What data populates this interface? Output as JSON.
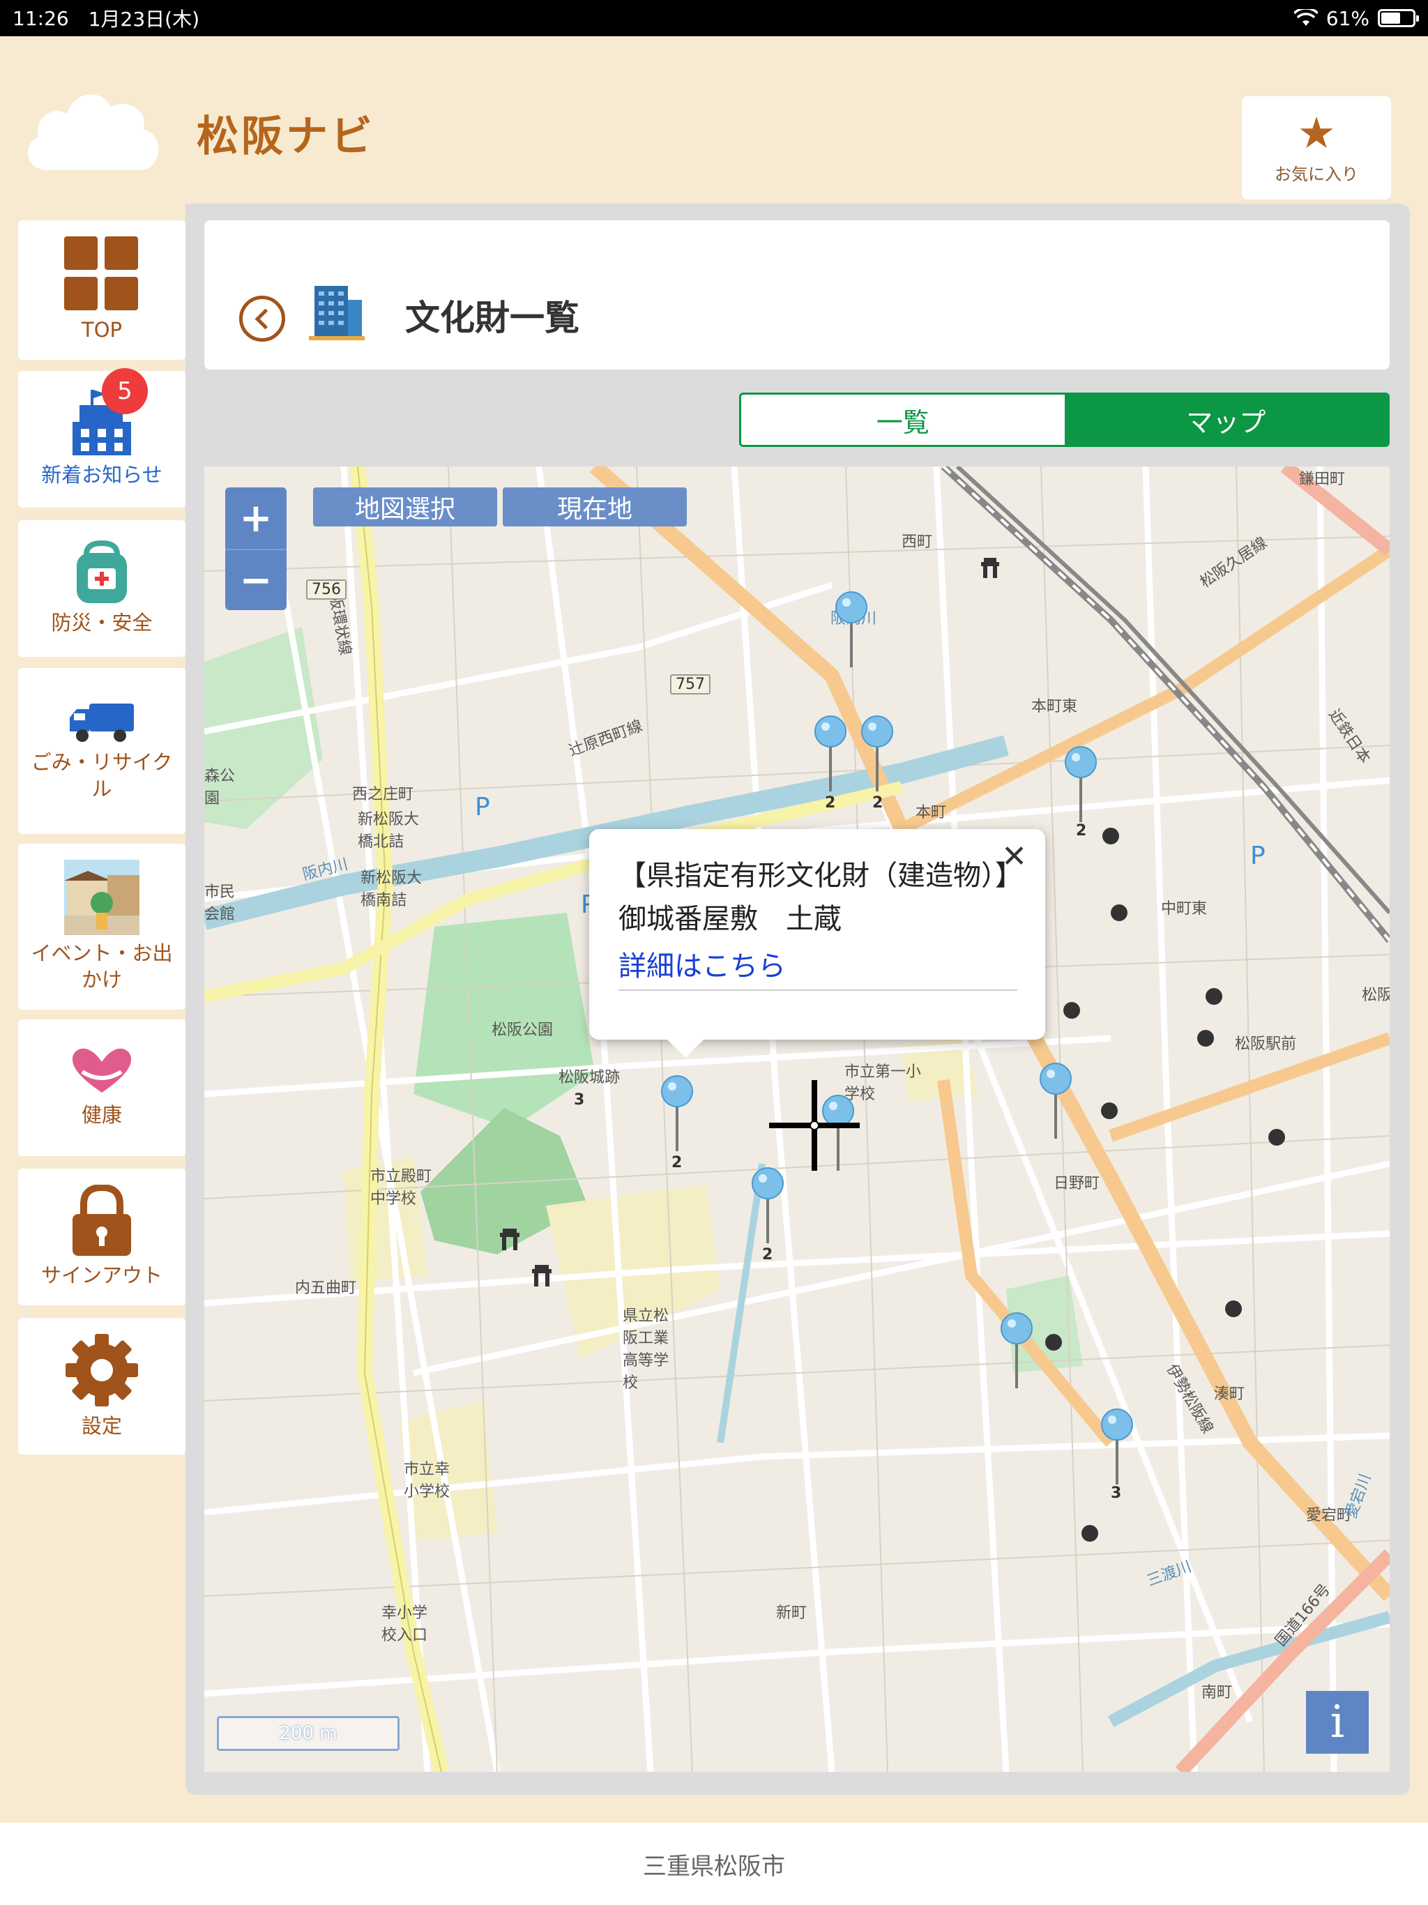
{
  "status_bar": {
    "time": "11:26",
    "date": "1月23日(木)",
    "battery": "61%",
    "battery_level": 0.61
  },
  "header": {
    "app_title": "松阪ナビ",
    "favorite_label": "お気に入り"
  },
  "sidebar": {
    "items": [
      {
        "label": "TOP",
        "icon": "grid-icon"
      },
      {
        "label": "新着お知らせ",
        "icon": "building-icon",
        "badge": "5"
      },
      {
        "label": "防災・安全",
        "icon": "backpack-icon"
      },
      {
        "label": "ごみ・リサイクル",
        "icon": "garbage-truck-icon"
      },
      {
        "label": "イベント・お出かけ",
        "icon": "event-icon"
      },
      {
        "label": "健康",
        "icon": "heart-hands-icon"
      },
      {
        "label": "サインアウト",
        "icon": "lock-icon"
      },
      {
        "label": "設定",
        "icon": "gear-icon"
      }
    ]
  },
  "main": {
    "title": "文化財一覧",
    "tabs": [
      {
        "label": "一覧",
        "selected": false
      },
      {
        "label": "マップ",
        "selected": true
      }
    ],
    "map": {
      "zoom_in": "+",
      "zoom_out": "−",
      "select_map_label": "地図選択",
      "current_location_label": "現在地",
      "popup": {
        "title": "【県指定有形文化財（建造物）】　御城番屋敷　土蔵",
        "link": "詳細はこちら"
      },
      "scale": "200 m",
      "info": "i",
      "labels": [
        "鎌田町",
        "西町",
        "阪内川",
        "本町東",
        "松阪久居線",
        "辻原西町線",
        "西之庄町",
        "新松阪大橋北詰",
        "新松阪大橋南詰",
        "森公園",
        "市民会館",
        "松阪公園",
        "松阪城跡",
        "中町東",
        "松阪駅前",
        "市立第一小学校",
        "日野町",
        "市立殿町中学校",
        "内五曲町",
        "県立松阪工業高等学校",
        "湊町",
        "市立幸小学校",
        "新町",
        "幸小学校入口",
        "愛宕町",
        "国道166号",
        "南町",
        "松阪環状線",
        "伊勢松阪線",
        "近鉄日本",
        "本町",
        "松阪",
        "阪内川",
        "愛宕川",
        "三渡川"
      ],
      "road_numbers": [
        "756",
        "757"
      ],
      "pin_counts": [
        "2",
        "2",
        "2",
        "2",
        "2",
        "3",
        "3"
      ]
    }
  },
  "footer": {
    "text": "三重県松阪市"
  },
  "colors": {
    "brand": "#b5651d",
    "accent_green": "#0c9744",
    "map_control": "#5e86c5",
    "badge": "#ee3b3b"
  }
}
